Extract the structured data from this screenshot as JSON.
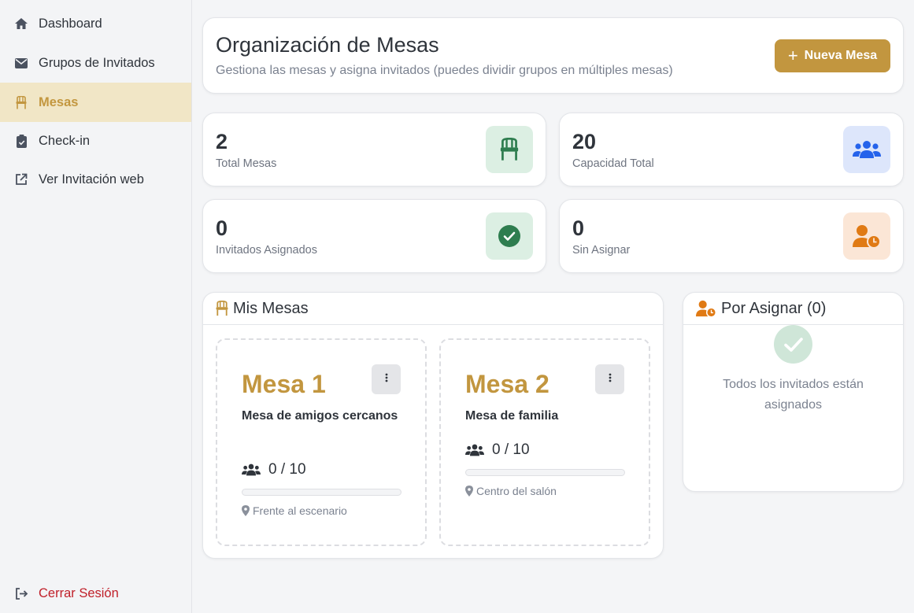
{
  "sidebar": {
    "items": [
      {
        "label": "Dashboard",
        "icon": "home-icon"
      },
      {
        "label": "Grupos de Invitados",
        "icon": "envelope-icon"
      },
      {
        "label": "Mesas",
        "icon": "chair-icon",
        "active": true
      },
      {
        "label": "Check-in",
        "icon": "clipboard-check-icon"
      },
      {
        "label": "Ver Invitación web",
        "icon": "external-link-icon"
      }
    ],
    "logout_label": "Cerrar Sesión"
  },
  "header": {
    "title": "Organización de Mesas",
    "subtitle": "Gestiona las mesas y asigna invitados (puedes dividir grupos en múltiples mesas)",
    "new_button_label": "Nueva Mesa"
  },
  "stats": [
    {
      "value": "2",
      "label": "Total Mesas",
      "icon": "chair-icon",
      "color": "#2e7d4f",
      "bg": "#dcefe3"
    },
    {
      "value": "20",
      "label": "Capacidad Total",
      "icon": "users-icon",
      "color": "#2563eb",
      "bg": "#dde6fb"
    },
    {
      "value": "0",
      "label": "Invitados Asignados",
      "icon": "check-circle-icon",
      "color": "#2e7d4f",
      "bg": "#dcefe3"
    },
    {
      "value": "0",
      "label": "Sin Asignar",
      "icon": "user-clock-icon",
      "color": "#e07a14",
      "bg": "#fbe6d6"
    }
  ],
  "mesas_section": {
    "title": "Mis Mesas",
    "tables": [
      {
        "name": "Mesa 1",
        "description": "Mesa de amigos cercanos",
        "assigned": 0,
        "capacity": 10,
        "capacity_text": "0 / 10",
        "location": "Frente al escenario"
      },
      {
        "name": "Mesa 2",
        "description": "Mesa de familia",
        "assigned": 0,
        "capacity": 10,
        "capacity_text": "0 / 10",
        "location": "Centro del salón"
      }
    ]
  },
  "unassigned_section": {
    "title": "Por Asignar (0)",
    "empty_message": "Todos los invitados están asignados"
  },
  "colors": {
    "accent": "#c2963f",
    "active_bg": "#f1e6c6",
    "logout": "#c0202a"
  }
}
